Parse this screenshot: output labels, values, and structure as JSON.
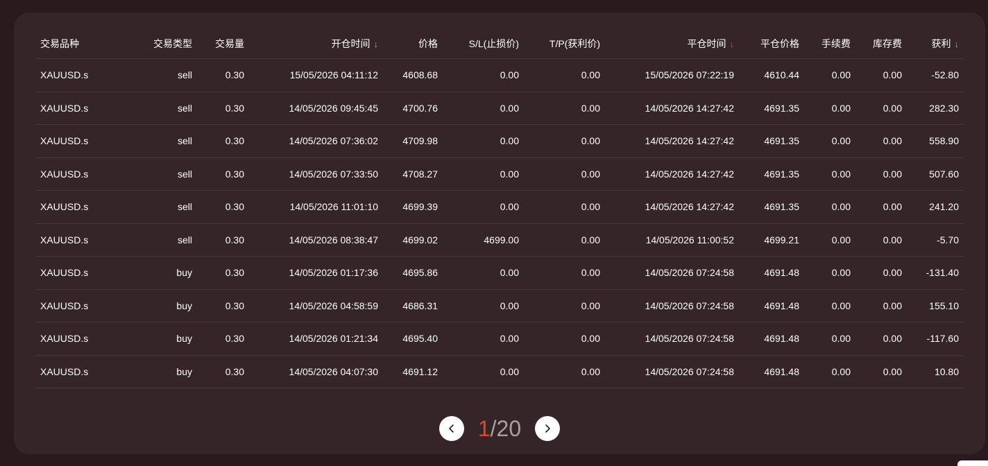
{
  "table": {
    "columns": [
      {
        "label": "交易品种",
        "sort": false
      },
      {
        "label": "交易类型",
        "sort": false
      },
      {
        "label": "交易量",
        "sort": false
      },
      {
        "label": "开仓时间",
        "sort": true,
        "sort_active": false
      },
      {
        "label": "价格",
        "sort": false
      },
      {
        "label": "S/L(止损价)",
        "sort": false
      },
      {
        "label": "T/P(获利价)",
        "sort": false
      },
      {
        "label": "平仓时间",
        "sort": true,
        "sort_active": true
      },
      {
        "label": "平仓价格",
        "sort": false
      },
      {
        "label": "手续费",
        "sort": false
      },
      {
        "label": "库存费",
        "sort": false
      },
      {
        "label": "获利",
        "sort": true,
        "sort_active": false
      }
    ],
    "rows": [
      [
        "XAUUSD.s",
        "sell",
        "0.30",
        "15/05/2026 04:11:12",
        "4608.68",
        "0.00",
        "0.00",
        "15/05/2026 07:22:19",
        "4610.44",
        "0.00",
        "0.00",
        "-52.80"
      ],
      [
        "XAUUSD.s",
        "sell",
        "0.30",
        "14/05/2026 09:45:45",
        "4700.76",
        "0.00",
        "0.00",
        "14/05/2026 14:27:42",
        "4691.35",
        "0.00",
        "0.00",
        "282.30"
      ],
      [
        "XAUUSD.s",
        "sell",
        "0.30",
        "14/05/2026 07:36:02",
        "4709.98",
        "0.00",
        "0.00",
        "14/05/2026 14:27:42",
        "4691.35",
        "0.00",
        "0.00",
        "558.90"
      ],
      [
        "XAUUSD.s",
        "sell",
        "0.30",
        "14/05/2026 07:33:50",
        "4708.27",
        "0.00",
        "0.00",
        "14/05/2026 14:27:42",
        "4691.35",
        "0.00",
        "0.00",
        "507.60"
      ],
      [
        "XAUUSD.s",
        "sell",
        "0.30",
        "14/05/2026 11:01:10",
        "4699.39",
        "0.00",
        "0.00",
        "14/05/2026 14:27:42",
        "4691.35",
        "0.00",
        "0.00",
        "241.20"
      ],
      [
        "XAUUSD.s",
        "sell",
        "0.30",
        "14/05/2026 08:38:47",
        "4699.02",
        "4699.00",
        "0.00",
        "14/05/2026 11:00:52",
        "4699.21",
        "0.00",
        "0.00",
        "-5.70"
      ],
      [
        "XAUUSD.s",
        "buy",
        "0.30",
        "14/05/2026 01:17:36",
        "4695.86",
        "0.00",
        "0.00",
        "14/05/2026 07:24:58",
        "4691.48",
        "0.00",
        "0.00",
        "-131.40"
      ],
      [
        "XAUUSD.s",
        "buy",
        "0.30",
        "14/05/2026 04:58:59",
        "4686.31",
        "0.00",
        "0.00",
        "14/05/2026 07:24:58",
        "4691.48",
        "0.00",
        "0.00",
        "155.10"
      ],
      [
        "XAUUSD.s",
        "buy",
        "0.30",
        "14/05/2026 01:21:34",
        "4695.40",
        "0.00",
        "0.00",
        "14/05/2026 07:24:58",
        "4691.48",
        "0.00",
        "0.00",
        "-117.60"
      ],
      [
        "XAUUSD.s",
        "buy",
        "0.30",
        "14/05/2026 04:07:30",
        "4691.12",
        "0.00",
        "0.00",
        "14/05/2026 07:24:58",
        "4691.48",
        "0.00",
        "0.00",
        "10.80"
      ]
    ]
  },
  "pagination": {
    "current": "1",
    "separator": "/",
    "total": "20",
    "prev_icon": "chevron-left-icon",
    "next_icon": "chevron-right-icon"
  },
  "colors": {
    "page_bg": "#2a1a1e",
    "panel_bg": "#352529",
    "accent": "#e2452a",
    "row_divider": "#4a3a3e"
  }
}
